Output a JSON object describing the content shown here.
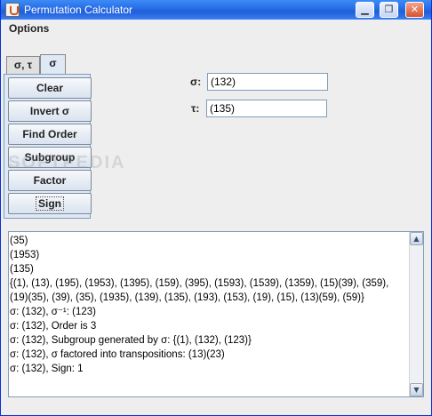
{
  "window": {
    "title": "Permutation Calculator",
    "controls": {
      "minimize": "▁",
      "maximize": "❐",
      "close": "✕"
    }
  },
  "menu": {
    "options": "Options"
  },
  "tabs": [
    {
      "label": "σ, τ",
      "active": false
    },
    {
      "label": "σ",
      "active": true
    }
  ],
  "buttons": {
    "clear": "Clear",
    "invert": "Invert σ",
    "find_order": "Find Order",
    "subgroup": "Subgroup",
    "factor": "Factor",
    "sign": "Sign"
  },
  "fields": {
    "sigma": {
      "label": "σ:",
      "value": "(132)"
    },
    "tau": {
      "label": "τ:",
      "value": "(135)"
    }
  },
  "output_lines": [
    "(35)",
    "(1953)",
    "(135)",
    "{(1), (13), (195), (1953), (1395), (159), (395), (1593), (1539), (1359), (15)(39), (359),",
    "(19)(35), (39), (35), (1935), (139), (135), (193), (153), (19), (15), (13)(59), (59)}",
    "σ: (132),  σ⁻¹: (123)",
    "σ: (132),  Order is 3",
    "σ: (132),  Subgroup generated by σ: {(1), (132), (123)}",
    "σ: (132),  σ factored into transpositions: (13)(23)",
    "σ: (132),  Sign: 1"
  ],
  "watermark": "SOFTPEDIA",
  "scroll": {
    "up": "▲",
    "down": "▼"
  }
}
